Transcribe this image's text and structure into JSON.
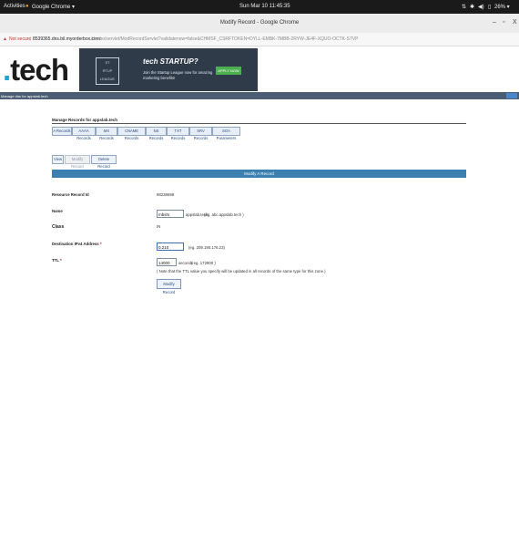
{
  "system_bar": {
    "activities": "Activities",
    "app_menu": "Google Chrome ▾",
    "datetime": "Sun Mar 10  11:45:35",
    "battery": "26% ▾"
  },
  "window": {
    "title": "Modify Record - Google Chrome",
    "minimize": "–",
    "maximize": "▫",
    "close": "X"
  },
  "address_bar": {
    "security": "Not secure",
    "url_host": "8539365.dns.bil.myorderbox.com",
    "url_path": "/dnsbo/servlet/ModRecordServlet?validatenow=false&CHMSF_CSRFTOKEN=DYLL-EMBK-7MBB-2RYW-JE4F-XQUO-OCTK-S7VP"
  },
  "banner": {
    "logo_main": "tech",
    "logo_dot": ".",
    "ad_startup": "ST\nRTUP\nLEAGUE",
    "ad_title": "tech STARTUP?",
    "ad_text": "Join the Startup League now for amazing marketing benefits!",
    "ad_button": "APPLY NOW"
  },
  "strip": {
    "text": "Manage dns for appslab.tech"
  },
  "manage": {
    "title": "Manage Records for appslab.tech",
    "record_tabs": [
      "A Records",
      "AAAA Records",
      "MX Records",
      "CNAME Records",
      "NS Records",
      "TXT Records",
      "SRV Records",
      "SOA Parameters"
    ]
  },
  "actions": {
    "view": "View",
    "modify": "Modify Record",
    "delete": "Delete Record"
  },
  "form": {
    "heading": "Modify A Record",
    "resource_id_label": "Resource Record Id",
    "resource_id_value": "98238698",
    "name_label": "Name",
    "name_value": "mbshr",
    "name_suffix": "appslab.tech",
    "name_hint": "(eg. abc.appslab.tech )",
    "class_label": "Class",
    "class_value": "IN",
    "ipv4_label": "Destination IPv4 Address",
    "ipv4_value": "0.210",
    "ipv4_hint": "(eg. 209.190.176.23)",
    "ttl_label": "TTL",
    "ttl_value": "14000",
    "ttl_unit": "seconds",
    "ttl_hint": "( eg. 172800 )",
    "ttl_note": "( Note that the TTL value you specify will be updated in all records of the same type for this zone.)",
    "submit": "Modify Record"
  },
  "colors": {
    "header_blue": "#3c7fb1",
    "strip": "#4b5e73",
    "logo_dot": "#1aa7d6"
  }
}
